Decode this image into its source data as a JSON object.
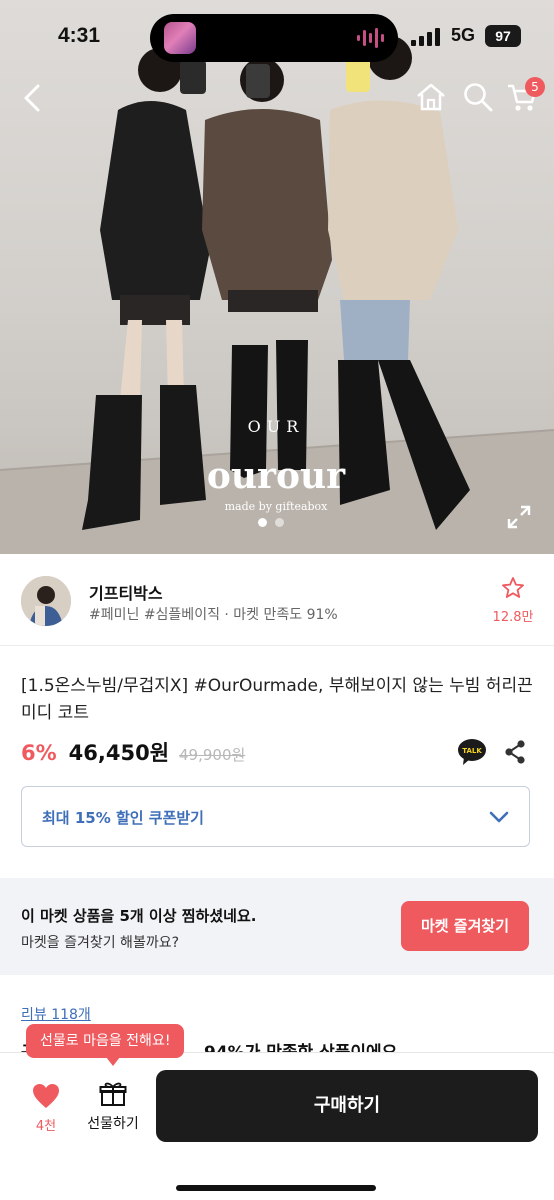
{
  "status_bar": {
    "time": "4:31",
    "network": "5G",
    "battery": "97"
  },
  "nav": {
    "cart_badge": "5"
  },
  "hero": {
    "brand_text": "ourour",
    "brand_arc": "OUR",
    "brand_sub": "made by gifteabox",
    "image_count": 2,
    "active_image": 1
  },
  "seller": {
    "name": "기프티박스",
    "tags": "#페미닌 #심플베이직 · 마켓 만족도 91%",
    "favorite_count": "12.8만"
  },
  "product": {
    "title": "[1.5온스누빔/무겁지X] #OurOurmade, 부해보이지 않는 누빔 허리끈 미디 코트",
    "discount": "6%",
    "price": "46,450원",
    "original_price": "49,900원",
    "talk_label": "TALK"
  },
  "coupon": {
    "label": "최대 15% 할인 쿠폰받기"
  },
  "market_banner": {
    "title": "이 마켓 상품을 5개 이상 찜하셨네요.",
    "subtitle": "마켓을 즐겨찾기 해볼까요?",
    "button": "마켓 즐겨찾기"
  },
  "review": {
    "link": "리뷰 118개",
    "peek_prefix": "구",
    "peek_text": "94%가 만족한 상품이에요"
  },
  "bottom_bar": {
    "like_count": "4천",
    "gift_label": "선물하기",
    "buy_label": "구매하기",
    "tooltip": "선물로 마음을 전해요!"
  },
  "colors": {
    "accent_red": "#ef5a5f",
    "link_blue": "#3f6fb8",
    "buy_dark": "#1c1c1c"
  }
}
